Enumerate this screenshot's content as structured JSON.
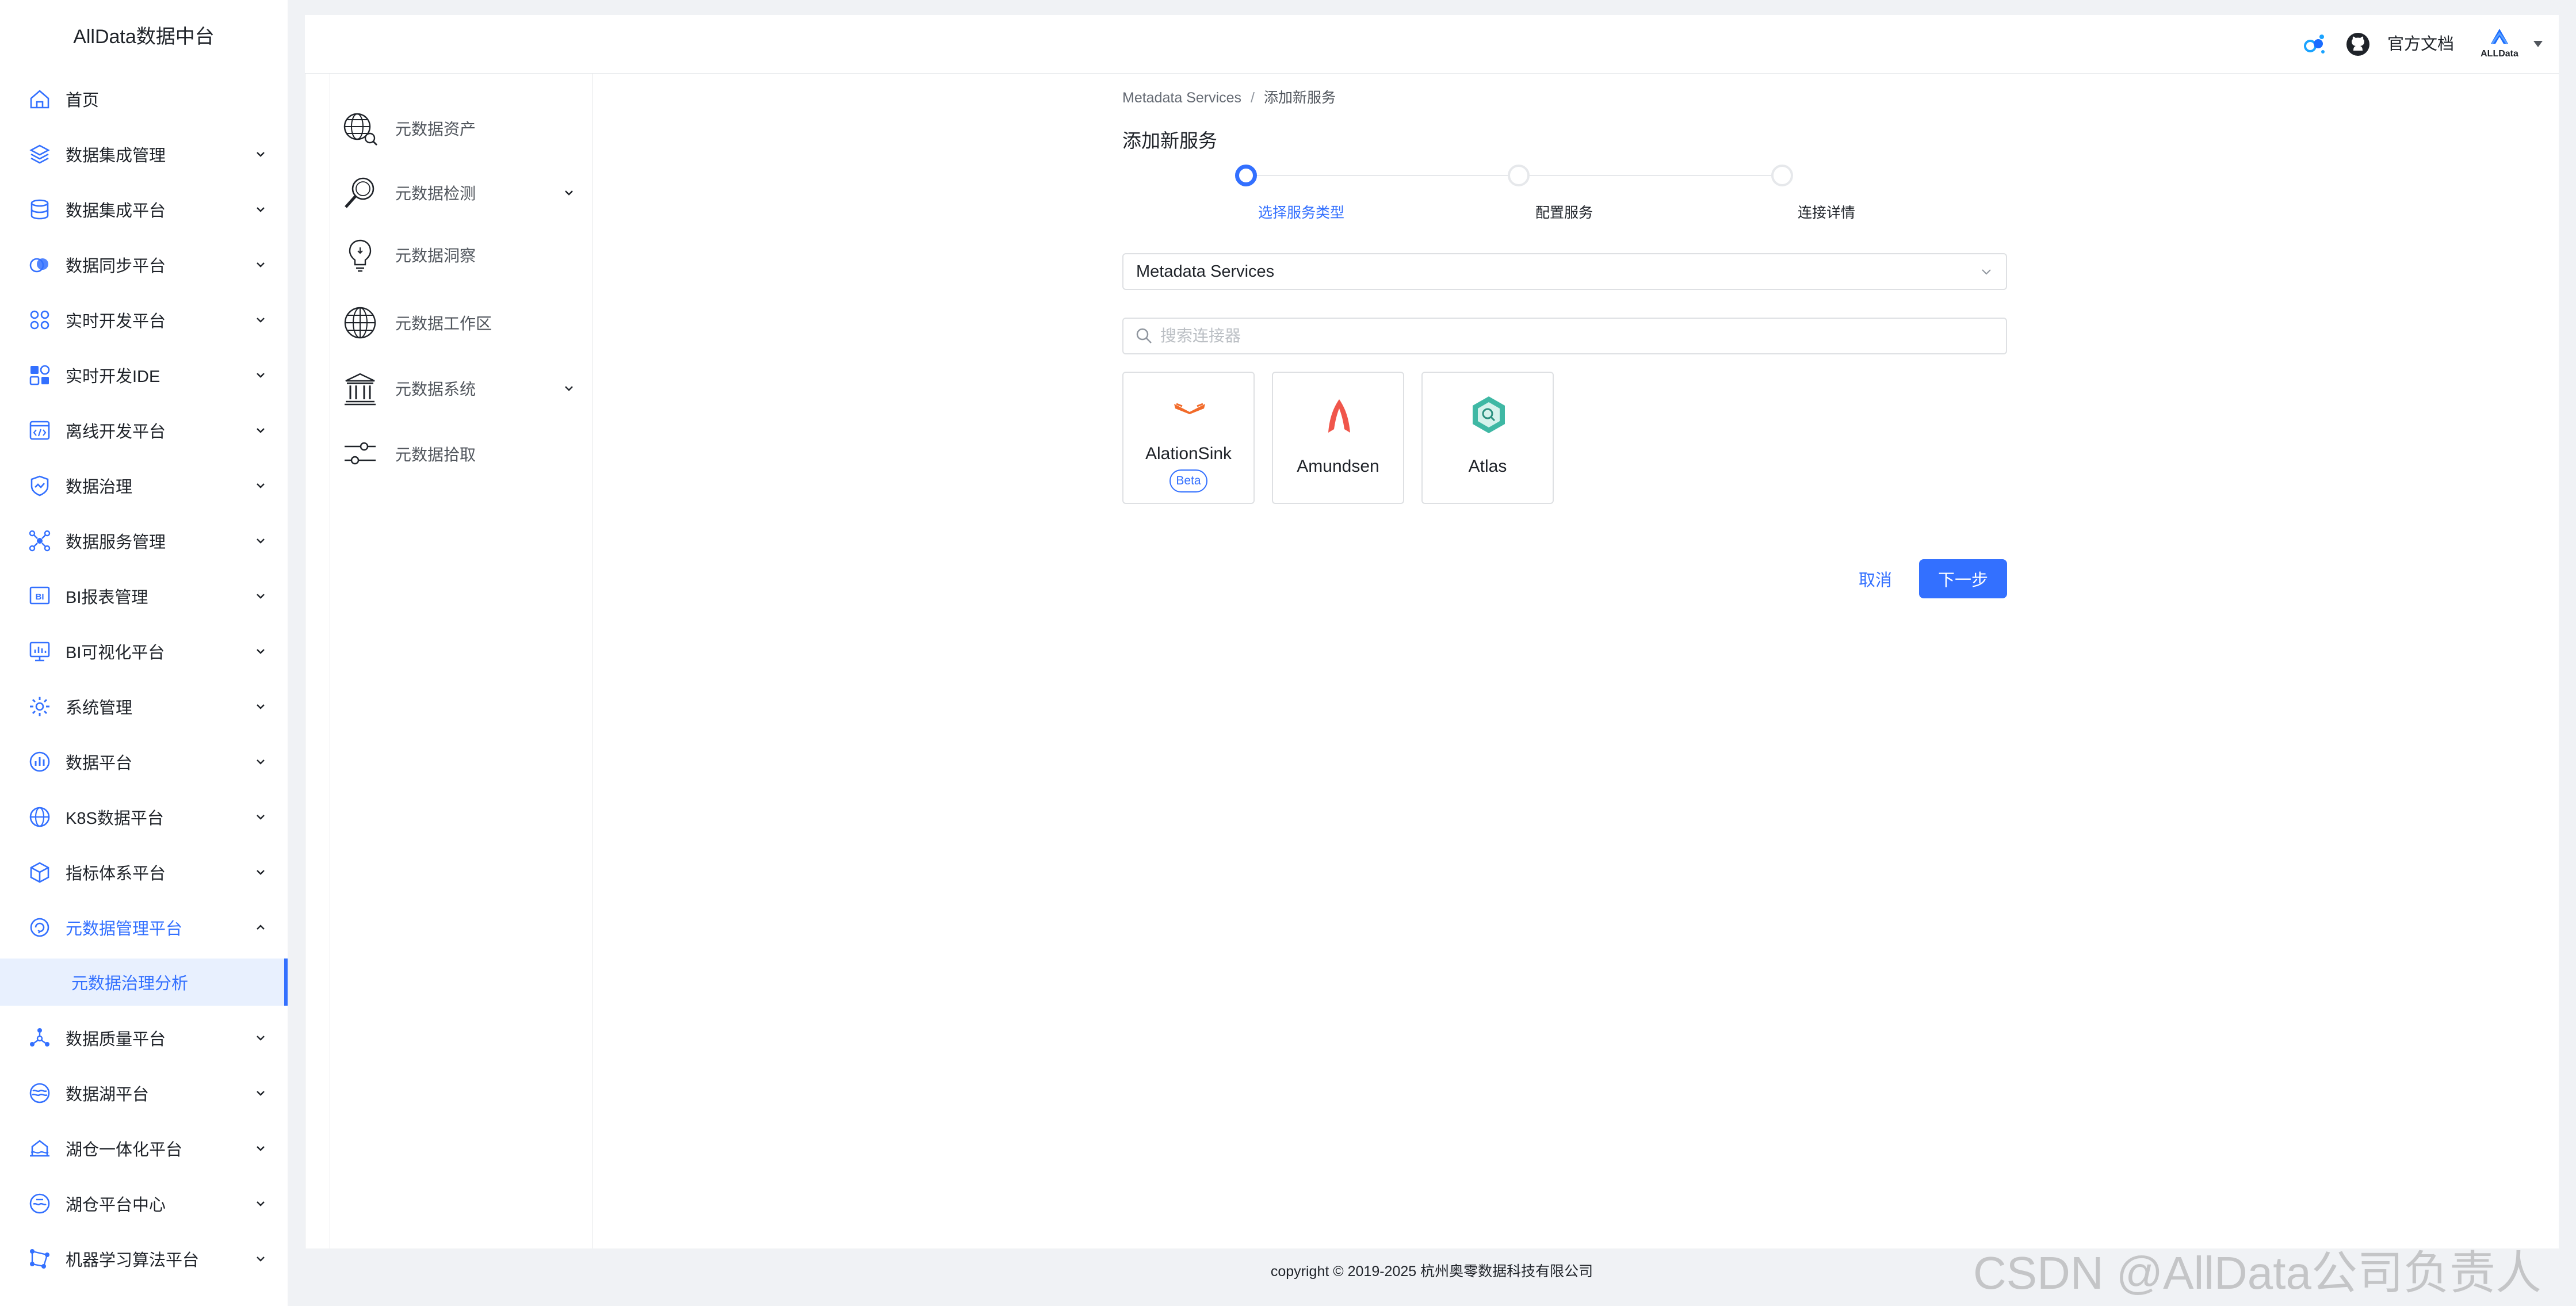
{
  "app": {
    "title": "AllData数据中台"
  },
  "sidebar": {
    "items": [
      {
        "label": "首页",
        "icon": "home-icon",
        "chevron": false
      },
      {
        "label": "数据集成管理",
        "icon": "layers-icon",
        "chevron": true
      },
      {
        "label": "数据集成平台",
        "icon": "database-icon",
        "chevron": true
      },
      {
        "label": "数据同步平台",
        "icon": "sync-icon",
        "chevron": true
      },
      {
        "label": "实时开发平台",
        "icon": "grid-icon",
        "chevron": true
      },
      {
        "label": "实时开发IDE",
        "icon": "ide-icon",
        "chevron": true
      },
      {
        "label": "离线开发平台",
        "icon": "code-window-icon",
        "chevron": true
      },
      {
        "label": "数据治理",
        "icon": "shield-chart-icon",
        "chevron": true
      },
      {
        "label": "数据服务管理",
        "icon": "network-icon",
        "chevron": true
      },
      {
        "label": "BI报表管理",
        "icon": "bi-report-icon",
        "chevron": true
      },
      {
        "label": "BI可视化平台",
        "icon": "monitor-chart-icon",
        "chevron": true
      },
      {
        "label": "系统管理",
        "icon": "settings-icon",
        "chevron": true
      },
      {
        "label": "数据平台",
        "icon": "bar-chart-icon",
        "chevron": true
      },
      {
        "label": "K8S数据平台",
        "icon": "globe-icon",
        "chevron": true
      },
      {
        "label": "指标体系平台",
        "icon": "cube-icon",
        "chevron": true
      },
      {
        "label": "元数据管理平台",
        "icon": "metadata-icon",
        "chevron": true,
        "active": true
      },
      {
        "label": "数据质量平台",
        "icon": "nodes-icon",
        "chevron": true
      },
      {
        "label": "数据湖平台",
        "icon": "lake-icon",
        "chevron": true
      },
      {
        "label": "湖仓一体化平台",
        "icon": "warehouse-icon",
        "chevron": true
      },
      {
        "label": "湖仓平台中心",
        "icon": "lake-center-icon",
        "chevron": true
      },
      {
        "label": "机器学习算法平台",
        "icon": "ml-icon",
        "chevron": true
      }
    ],
    "active_sub_item": "元数据治理分析"
  },
  "header": {
    "docs_label": "官方文档",
    "icons": [
      "connect-icon",
      "github-icon",
      "user-avatar",
      "caret-down-icon"
    ]
  },
  "subnav": {
    "items": [
      {
        "label": "元数据资产",
        "icon": "globe-search-icon",
        "chevron": false
      },
      {
        "label": "元数据检测",
        "icon": "magnifier-icon",
        "chevron": true
      },
      {
        "label": "元数据洞察",
        "icon": "lightbulb-icon",
        "chevron": false
      },
      {
        "label": "元数据工作区",
        "icon": "globe-grid-icon",
        "chevron": false
      },
      {
        "label": "元数据系统",
        "icon": "institution-icon",
        "chevron": true
      },
      {
        "label": "元数据拾取",
        "icon": "sliders-icon",
        "chevron": false
      }
    ]
  },
  "breadcrumb": {
    "parent": "Metadata Services",
    "separator": "/",
    "current": "添加新服务"
  },
  "page": {
    "title": "添加新服务"
  },
  "steps": [
    {
      "label": "选择服务类型",
      "current": true
    },
    {
      "label": "配置服务",
      "current": false
    },
    {
      "label": "连接详情",
      "current": false
    }
  ],
  "service_type": {
    "selected": "Metadata Services"
  },
  "search": {
    "placeholder": "搜索连接器",
    "value": ""
  },
  "connectors": [
    {
      "name": "AlationSink",
      "badge": "Beta",
      "icon": "alation-logo"
    },
    {
      "name": "Amundsen",
      "badge": "",
      "icon": "amundsen-logo"
    },
    {
      "name": "Atlas",
      "badge": "",
      "icon": "atlas-logo"
    }
  ],
  "actions": {
    "cancel": "取消",
    "next": "下一步"
  },
  "footer": {
    "copyright": "copyright © 2019-2025 杭州奥零数据科技有限公司"
  },
  "watermark": "CSDN @AllData公司负责人",
  "colors": {
    "accent": "#3370ff",
    "text": "#1f2329",
    "border": "#dee0e3",
    "background": "#f0f2f5"
  }
}
